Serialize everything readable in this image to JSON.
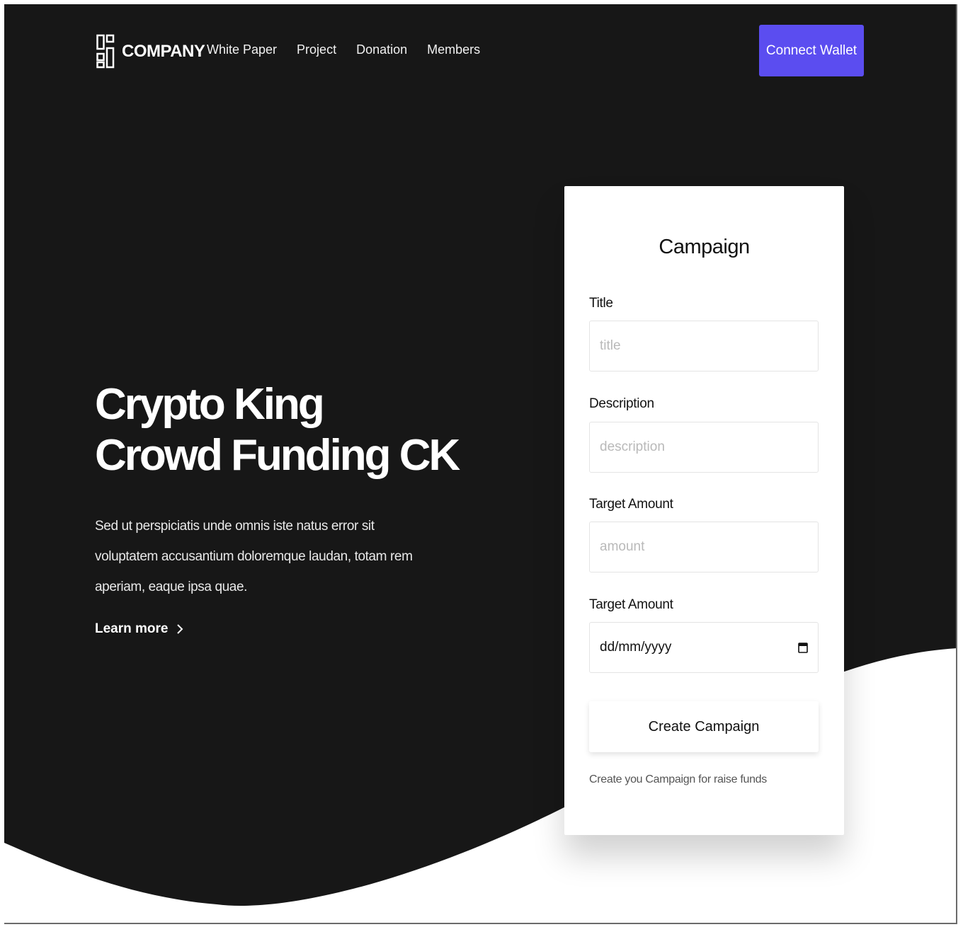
{
  "brand": {
    "name": "COMPANY"
  },
  "nav": {
    "items": [
      "White Paper",
      "Project",
      "Donation",
      "Members"
    ],
    "cta": "Connect Wallet"
  },
  "hero": {
    "title_line1": "Crypto King",
    "title_line2": "Crowd Funding CK",
    "description": "Sed ut perspiciatis unde omnis iste natus error sit voluptatem accusantium doloremque laudan, totam rem aperiam, eaque ipsa quae.",
    "link": "Learn more"
  },
  "form": {
    "heading": "Campaign",
    "title_label": "Title",
    "title_placeholder": "title",
    "description_label": "Description",
    "description_placeholder": "description",
    "amount_label": "Target Amount",
    "amount_placeholder": "amount",
    "date_label": "Target Amount",
    "date_value": "dd/mm/yyyy",
    "submit": "Create Campaign",
    "helper": "Create you Campaign for raise funds"
  },
  "colors": {
    "dark_bg": "#171717",
    "accent": "#5b4df0",
    "card": "#ffffff"
  },
  "icons": {
    "logo": "squares-logo-icon",
    "link_chevron": "chevron-right-icon",
    "calendar": "calendar-icon"
  }
}
